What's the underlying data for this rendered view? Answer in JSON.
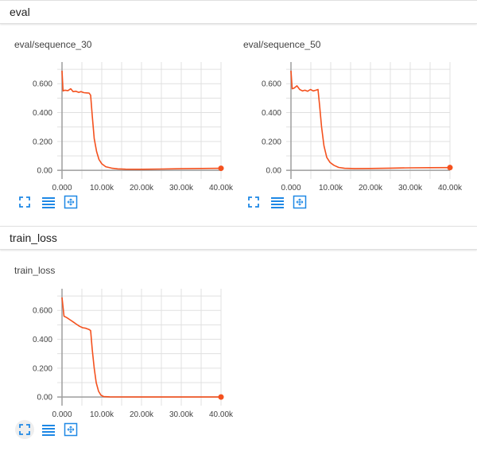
{
  "colors": {
    "series": "#f4511e",
    "axis": "#9e9e9e",
    "grid": "#e0e0e0",
    "icon": "#1e88e5"
  },
  "icons": [
    "fit-domain-icon",
    "data-table-icon",
    "log-scale-icon"
  ],
  "sections": [
    {
      "title": "eval",
      "cards": [
        {
          "title": "eval/sequence_30"
        },
        {
          "title": "eval/sequence_50"
        }
      ]
    },
    {
      "title": "train_loss",
      "cards": [
        {
          "title": "train_loss"
        }
      ]
    }
  ],
  "chart_data": [
    {
      "type": "line",
      "title": "eval/sequence_30",
      "xlim": [
        0,
        40000
      ],
      "ylim": [
        -0.06,
        0.75
      ],
      "x_ticks": [
        0,
        10000,
        20000,
        30000,
        40000
      ],
      "x_tick_labels": [
        "0.000",
        "10.00k",
        "20.00k",
        "30.00k",
        "40.00k"
      ],
      "y_ticks": [
        0,
        0.2,
        0.4,
        0.6
      ],
      "y_tick_labels": [
        "0.00",
        "0.200",
        "0.400",
        "0.600"
      ],
      "grid": true,
      "series": [
        {
          "points": [
            [
              0,
              0.69
            ],
            [
              250,
              0.55
            ],
            [
              700,
              0.555
            ],
            [
              1500,
              0.552
            ],
            [
              2200,
              0.565
            ],
            [
              2800,
              0.545
            ],
            [
              3500,
              0.548
            ],
            [
              4200,
              0.54
            ],
            [
              4800,
              0.545
            ],
            [
              5500,
              0.538
            ],
            [
              6200,
              0.536
            ],
            [
              6800,
              0.535
            ],
            [
              7200,
              0.52
            ],
            [
              7600,
              0.38
            ],
            [
              8100,
              0.22
            ],
            [
              8700,
              0.13
            ],
            [
              9300,
              0.075
            ],
            [
              10000,
              0.045
            ],
            [
              11000,
              0.025
            ],
            [
              12500,
              0.015
            ],
            [
              14000,
              0.01
            ],
            [
              16000,
              0.008
            ],
            [
              20000,
              0.007
            ],
            [
              25000,
              0.009
            ],
            [
              30000,
              0.011
            ],
            [
              35000,
              0.013
            ],
            [
              40000,
              0.014
            ]
          ],
          "last_point": [
            40000,
            0.014
          ]
        }
      ]
    },
    {
      "type": "line",
      "title": "eval/sequence_50",
      "xlim": [
        0,
        40000
      ],
      "ylim": [
        -0.06,
        0.75
      ],
      "x_ticks": [
        0,
        10000,
        20000,
        30000,
        40000
      ],
      "x_tick_labels": [
        "0.000",
        "10.00k",
        "20.00k",
        "30.00k",
        "40.00k"
      ],
      "y_ticks": [
        0,
        0.2,
        0.4,
        0.6
      ],
      "y_tick_labels": [
        "0.00",
        "0.200",
        "0.400",
        "0.600"
      ],
      "grid": true,
      "series": [
        {
          "points": [
            [
              0,
              0.69
            ],
            [
              300,
              0.565
            ],
            [
              800,
              0.57
            ],
            [
              1500,
              0.585
            ],
            [
              2200,
              0.56
            ],
            [
              2900,
              0.55
            ],
            [
              3500,
              0.555
            ],
            [
              4200,
              0.548
            ],
            [
              4900,
              0.56
            ],
            [
              5600,
              0.55
            ],
            [
              6300,
              0.555
            ],
            [
              6800,
              0.56
            ],
            [
              7200,
              0.45
            ],
            [
              7700,
              0.3
            ],
            [
              8300,
              0.17
            ],
            [
              9000,
              0.09
            ],
            [
              9800,
              0.055
            ],
            [
              10800,
              0.035
            ],
            [
              12000,
              0.02
            ],
            [
              13500,
              0.014
            ],
            [
              16000,
              0.012
            ],
            [
              20000,
              0.013
            ],
            [
              25000,
              0.015
            ],
            [
              30000,
              0.017
            ],
            [
              35000,
              0.018
            ],
            [
              40000,
              0.019
            ]
          ],
          "last_point": [
            40000,
            0.019
          ]
        }
      ]
    },
    {
      "type": "line",
      "title": "train_loss",
      "xlim": [
        0,
        40000
      ],
      "ylim": [
        -0.06,
        0.75
      ],
      "x_ticks": [
        0,
        10000,
        20000,
        30000,
        40000
      ],
      "x_tick_labels": [
        "0.000",
        "10.00k",
        "20.00k",
        "30.00k",
        "40.00k"
      ],
      "y_ticks": [
        0,
        0.2,
        0.4,
        0.6
      ],
      "y_tick_labels": [
        "0.00",
        "0.200",
        "0.400",
        "0.600"
      ],
      "grid": true,
      "series": [
        {
          "points": [
            [
              0,
              0.69
            ],
            [
              500,
              0.56
            ],
            [
              1200,
              0.55
            ],
            [
              2000,
              0.535
            ],
            [
              2800,
              0.52
            ],
            [
              3600,
              0.505
            ],
            [
              4400,
              0.49
            ],
            [
              5200,
              0.48
            ],
            [
              6000,
              0.476
            ],
            [
              6800,
              0.468
            ],
            [
              7200,
              0.46
            ],
            [
              7600,
              0.33
            ],
            [
              8100,
              0.2
            ],
            [
              8600,
              0.1
            ],
            [
              9200,
              0.04
            ],
            [
              9800,
              0.012
            ],
            [
              10500,
              0.003
            ],
            [
              12000,
              0.001
            ],
            [
              20000,
              0.0
            ],
            [
              30000,
              0.0
            ],
            [
              40000,
              0.0
            ]
          ],
          "last_point": [
            40000,
            0.0
          ]
        }
      ]
    }
  ]
}
